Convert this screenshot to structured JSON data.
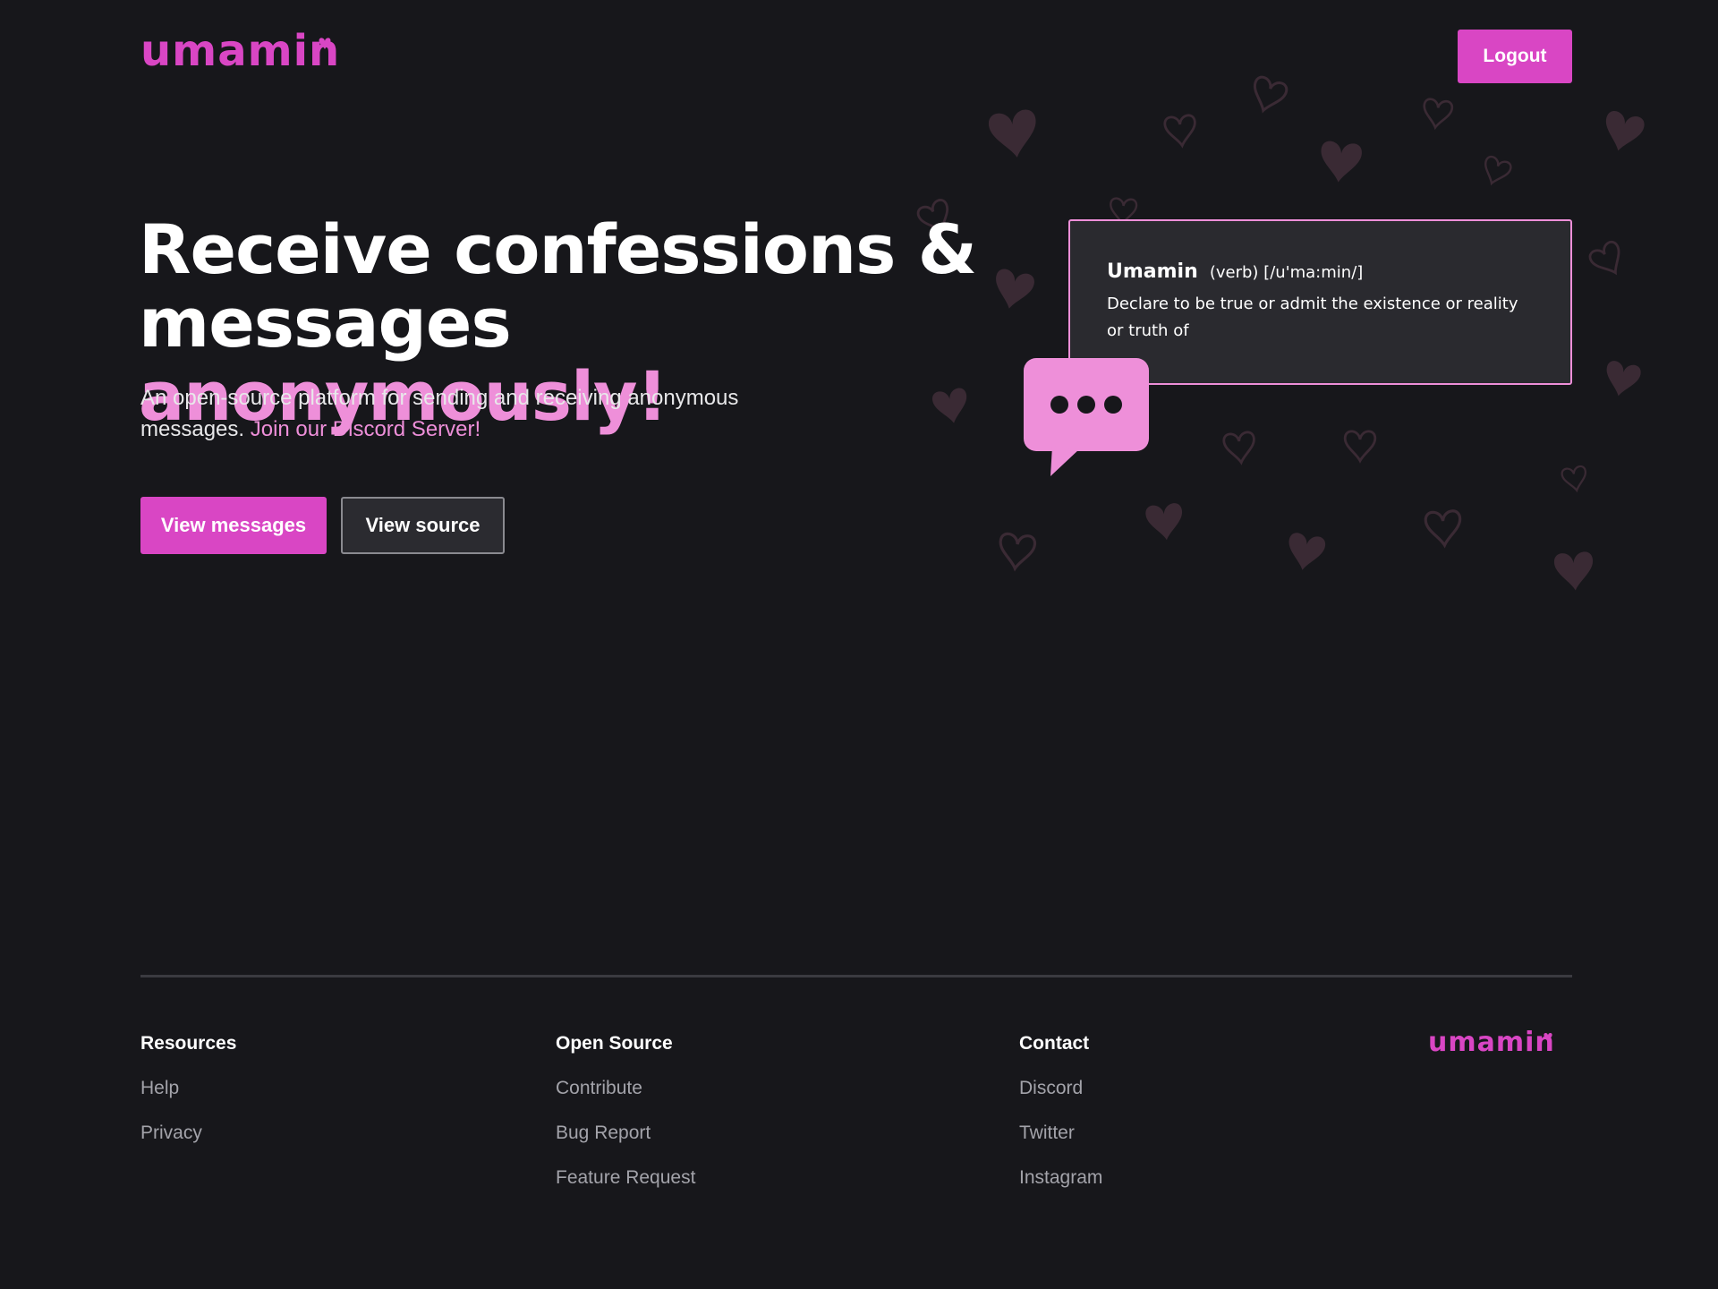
{
  "header": {
    "logo_text": "umamin",
    "logout_label": "Logout"
  },
  "hero": {
    "headline_part1": "Receive confessions &",
    "headline_part2": "messages",
    "headline_accent": "anonymously!",
    "subtext": "An open-source platform for sending and receiving anonymous messages.",
    "discord_link": "Join our Discord Server!",
    "primary_button": "View messages",
    "secondary_button": "View source"
  },
  "definition": {
    "word": "Umamin",
    "pronunciation": "(verb) [/u'ma:min/]",
    "meaning": "Declare to be true or admit the existence or reality or truth of"
  },
  "footer": {
    "columns": [
      {
        "heading": "Resources",
        "links": [
          "Help",
          "Privacy"
        ]
      },
      {
        "heading": "Open Source",
        "links": [
          "Contribute",
          "Bug Report",
          "Feature Request"
        ]
      },
      {
        "heading": "Contact",
        "links": [
          "Discord",
          "Twitter",
          "Instagram"
        ]
      }
    ],
    "logo_text": "umamin"
  },
  "colors": {
    "background": "#17171b",
    "brand": "#d946c4",
    "accent_light": "#ee8fd9",
    "card": "#2a2a2f",
    "muted_text": "#a3a3aa"
  },
  "icons": {
    "chat": "chat-bubble-ellipsis-icon",
    "hearts": "heart-icon"
  }
}
